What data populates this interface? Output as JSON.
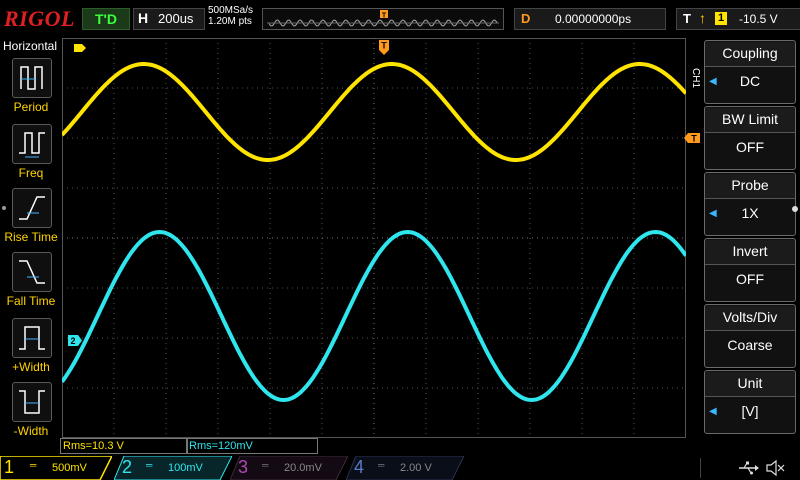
{
  "header": {
    "brand": "RIGOL",
    "run_status": "T'D",
    "horizontal_letter": "H",
    "timebase": "200us",
    "sample_rate": "500MSa/s",
    "memory_depth": "1.20M pts",
    "trigger_marker": "T",
    "delay_letter": "D",
    "delay_value": "0.00000000ps",
    "trigger_letter": "T",
    "trigger_edge": "↑",
    "trigger_source": "1",
    "trigger_level": "-10.5 V"
  },
  "left_menu": {
    "title": "Horizontal",
    "items": [
      {
        "label": "Period",
        "icon": "period-icon"
      },
      {
        "label": "Freq",
        "icon": "frequency-icon"
      },
      {
        "label": "Rise Time",
        "icon": "rise-time-icon"
      },
      {
        "label": "Fall Time",
        "icon": "fall-time-icon"
      },
      {
        "label": "+Width",
        "icon": "positive-width-icon"
      },
      {
        "label": "-Width",
        "icon": "negative-width-icon"
      }
    ]
  },
  "right_menu": {
    "channel_tag": "CH1",
    "items": [
      {
        "title": "Coupling",
        "value": "DC",
        "has_arrow": true
      },
      {
        "title": "BW Limit",
        "value": "OFF",
        "has_arrow": false
      },
      {
        "title": "Probe",
        "value": "1X",
        "has_arrow": true
      },
      {
        "title": "Invert",
        "value": "OFF",
        "has_arrow": false
      },
      {
        "title": "Volts/Div",
        "value": "Coarse",
        "has_arrow": false
      },
      {
        "title": "Unit",
        "value": "[V]",
        "has_arrow": true
      }
    ]
  },
  "markers": {
    "ch1_trigger_level_tag": "T",
    "ch2_offset_tag": "2"
  },
  "measurements": [
    {
      "text": "Rms=10.3 V",
      "color": "#ffe400"
    },
    {
      "text": "Rms=120mV",
      "color": "#2fe6ee"
    }
  ],
  "channels": [
    {
      "num": "1",
      "scale": "500mV",
      "color": "#ffe400",
      "active": true
    },
    {
      "num": "2",
      "scale": "100mV",
      "color": "#2fe6ee",
      "active": true
    },
    {
      "num": "3",
      "scale": "20.0mV",
      "color": "#b04ab0",
      "active": false
    },
    {
      "num": "4",
      "scale": "2.00 V",
      "color": "#5a7ac8",
      "active": false
    }
  ],
  "colors": {
    "ch1": "#ffe400",
    "ch2": "#2fe6ee",
    "trigger": "#ff9a1c",
    "grid": "#555555"
  },
  "status_icons": [
    "usb-icon",
    "speaker-mute-icon"
  ]
}
